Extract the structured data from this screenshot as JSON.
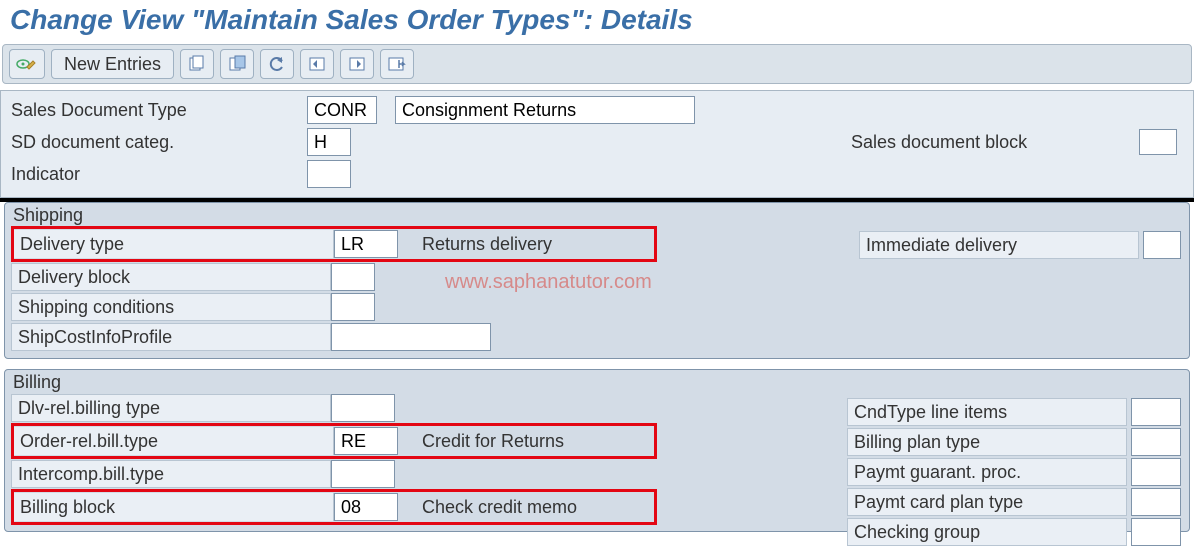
{
  "title": "Change View \"Maintain Sales Order Types\": Details",
  "toolbar": {
    "new_entries_label": "New Entries"
  },
  "header": {
    "sales_doc_type_label": "Sales Document Type",
    "sales_doc_type_code": "CONR",
    "sales_doc_type_desc": "Consignment Returns",
    "sd_doc_categ_label": "SD document categ.",
    "sd_doc_categ_value": "H",
    "indicator_label": "Indicator",
    "indicator_value": "",
    "sales_doc_block_label": "Sales document block",
    "sales_doc_block_value": ""
  },
  "shipping": {
    "section_title": "Shipping",
    "delivery_type_label": "Delivery type",
    "delivery_type_value": "LR",
    "delivery_type_desc": "Returns delivery",
    "delivery_block_label": "Delivery block",
    "delivery_block_value": "",
    "shipping_conditions_label": "Shipping conditions",
    "shipping_conditions_value": "",
    "shipcost_profile_label": "ShipCostInfoProfile",
    "shipcost_profile_value": "",
    "immediate_delivery_label": "Immediate delivery",
    "immediate_delivery_value": ""
  },
  "billing": {
    "section_title": "Billing",
    "dlv_rel_bill_type_label": "Dlv-rel.billing type",
    "dlv_rel_bill_type_value": "",
    "order_rel_bill_type_label": "Order-rel.bill.type",
    "order_rel_bill_type_value": "RE",
    "order_rel_bill_type_desc": "Credit for Returns",
    "intercomp_bill_type_label": "Intercomp.bill.type",
    "intercomp_bill_type_value": "",
    "billing_block_label": "Billing block",
    "billing_block_value": "08",
    "billing_block_desc": "Check credit memo",
    "cndtype_line_items_label": "CndType line items",
    "billing_plan_type_label": "Billing plan type",
    "paymt_guarant_proc_label": "Paymt guarant. proc.",
    "paymt_card_plan_type_label": "Paymt card plan type",
    "checking_group_label": "Checking group"
  },
  "watermark": "www.saphanatutor.com"
}
